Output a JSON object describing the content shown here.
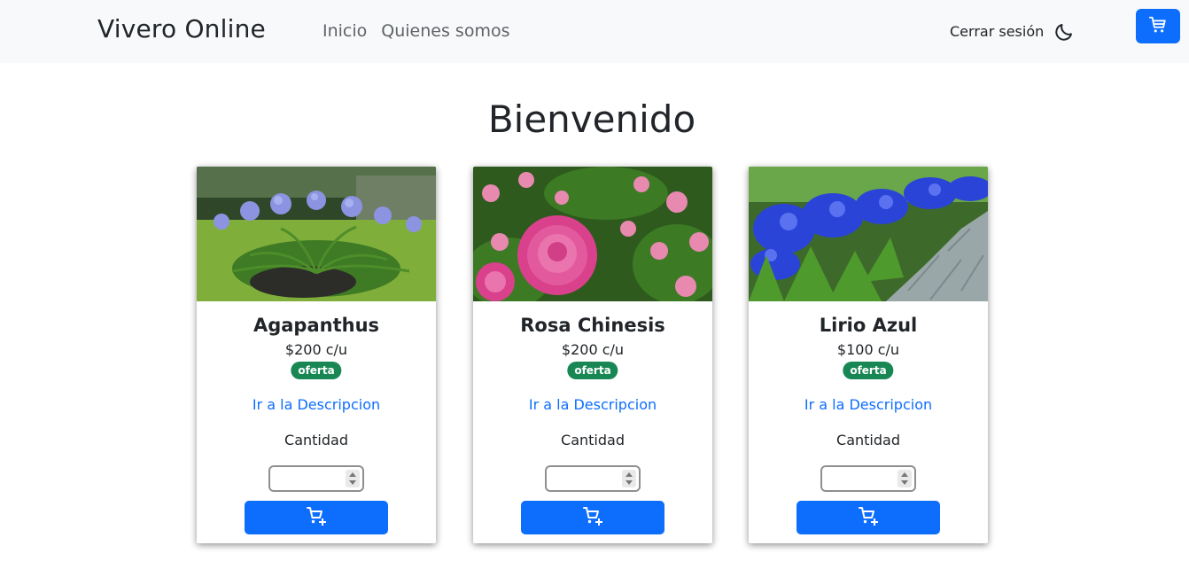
{
  "navbar": {
    "brand": "Vivero Online",
    "links": [
      {
        "label": "Inicio"
      },
      {
        "label": "Quienes somos"
      }
    ],
    "logout": "Cerrar sesión",
    "theme_icon": "moon-icon",
    "cart_icon": "cart-icon",
    "accent_color": "#0d6efd"
  },
  "main": {
    "title": "Bienvenido"
  },
  "products": [
    {
      "name": "Agapanthus",
      "price": "$200 c/u",
      "badge": "oferta",
      "link": "Ir a la Descripcion",
      "qty_label": "Cantidad",
      "qty_value": "",
      "image": "agapanthus-garden-photo"
    },
    {
      "name": "Rosa Chinesis",
      "price": "$200 c/u",
      "badge": "oferta",
      "link": "Ir a la Descripcion",
      "qty_label": "Cantidad",
      "qty_value": "",
      "image": "pink-rose-photo"
    },
    {
      "name": "Lirio Azul",
      "price": "$100 c/u",
      "badge": "oferta",
      "link": "Ir a la Descripcion",
      "qty_label": "Cantidad",
      "qty_value": "",
      "image": "blue-lily-border-photo"
    }
  ],
  "colors": {
    "badge": "#198754",
    "link": "#0d6efd",
    "button": "#0d6efd",
    "navbar_bg": "#f8f9fa"
  }
}
